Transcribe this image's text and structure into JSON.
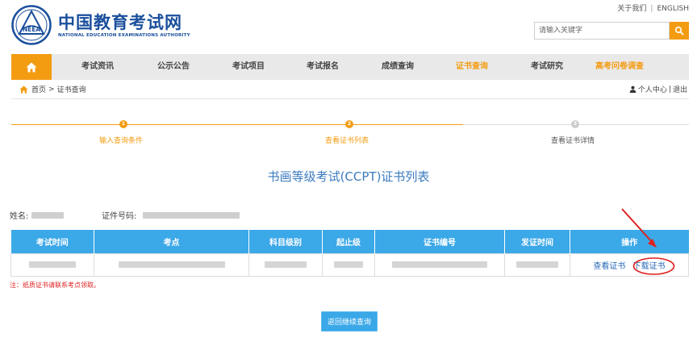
{
  "header": {
    "logo_cn": "中国教育考试网",
    "logo_en": "NATIONAL EDUCATION EXAMINATIONS AUTHORITY",
    "emblem_text": "NEEA",
    "about_link": "关于我们",
    "link_sep": "|",
    "english_link": "ENGLISH",
    "search_placeholder": "请输入关键字"
  },
  "nav": {
    "items": [
      {
        "label": "考试资讯"
      },
      {
        "label": "公示公告"
      },
      {
        "label": "考试项目"
      },
      {
        "label": "考试报名"
      },
      {
        "label": "成绩查询"
      },
      {
        "label": "证书查询"
      },
      {
        "label": "考试研究"
      },
      {
        "label": "高考问卷调查"
      }
    ],
    "active_index": 5
  },
  "breadcrumb": {
    "home": "首页",
    "sep": ">",
    "current": "证书查询"
  },
  "user_links": {
    "center": "个人中心",
    "sep": "|",
    "logout": "退出"
  },
  "steps": [
    {
      "number": "1",
      "label": "输入查询条件",
      "state": "done"
    },
    {
      "number": "2",
      "label": "查看证书列表",
      "state": "current"
    },
    {
      "number": "3",
      "label": "查看证书详情",
      "state": "pending"
    }
  ],
  "page_title": "书画等级考试(CCPT)证书列表",
  "info": {
    "name_label": "姓名:",
    "id_label": "证件号码:"
  },
  "table": {
    "headers": [
      "考试时间",
      "考点",
      "科目级别",
      "起止级",
      "证书编号",
      "发证时间",
      "操作"
    ],
    "row": {
      "view_link": "查看证书",
      "download_link": "下载证书"
    }
  },
  "note": "注：纸质证书请联系考点领取。",
  "back_button": "返回继续查询",
  "colors": {
    "brand_blue": "#1a4f9c",
    "accent_orange": "#f39c12",
    "table_header": "#3ba8e8",
    "annotation_red": "#e02020"
  }
}
